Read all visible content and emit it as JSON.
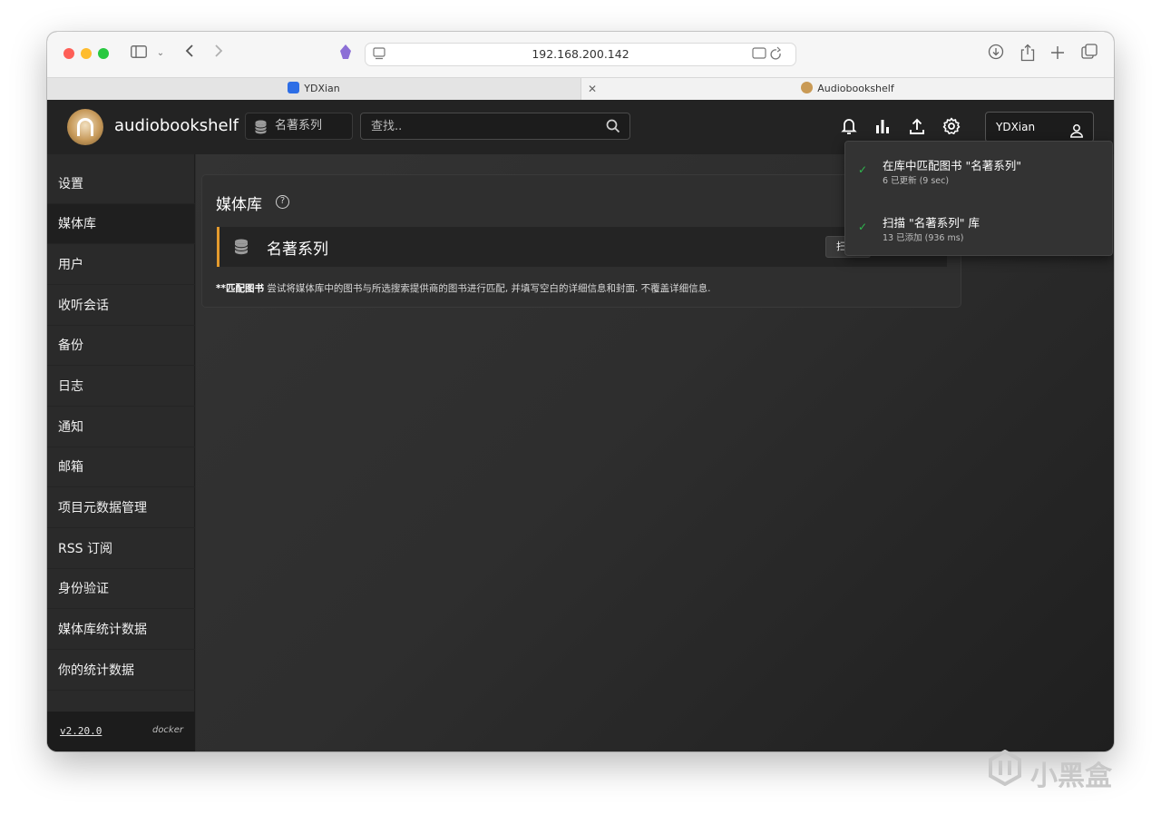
{
  "browser": {
    "url": "192.168.200.142",
    "tabs": [
      {
        "label": "YDXian"
      },
      {
        "label": "Audiobookshelf"
      }
    ]
  },
  "app": {
    "brand": "audiobookshelf",
    "library_select": "名著系列",
    "search_placeholder": "查找..",
    "user_name": "YDXian"
  },
  "sidebar": {
    "items": [
      {
        "label": "设置"
      },
      {
        "label": "媒体库"
      },
      {
        "label": "用户"
      },
      {
        "label": "收听会话"
      },
      {
        "label": "备份"
      },
      {
        "label": "日志"
      },
      {
        "label": "通知"
      },
      {
        "label": "邮箱"
      },
      {
        "label": "项目元数据管理"
      },
      {
        "label": "RSS 订阅"
      },
      {
        "label": "身份验证"
      },
      {
        "label": "媒体库统计数据"
      },
      {
        "label": "你的统计数据"
      }
    ],
    "active_index": 1,
    "version": "v2.20.0",
    "platform": "docker"
  },
  "main": {
    "title": "媒体库",
    "library_name": "名著系列",
    "scan_label": "扫",
    "note_bold": "**匹配图书",
    "note_text": " 尝试将媒体库中的图书与所选搜索提供商的图书进行匹配, 并填写空白的详细信息和封面. 不覆盖详细信息."
  },
  "notifications": [
    {
      "title": "在库中匹配图书 \"名著系列\"",
      "detail": "6 已更新 (9 sec)"
    },
    {
      "title": "扫描 \"名著系列\" 库",
      "detail": "13 已添加 (936 ms)"
    }
  ],
  "watermark": "小黑盒",
  "colors": {
    "accent": "#e39a2d",
    "success": "#2fb84e"
  }
}
